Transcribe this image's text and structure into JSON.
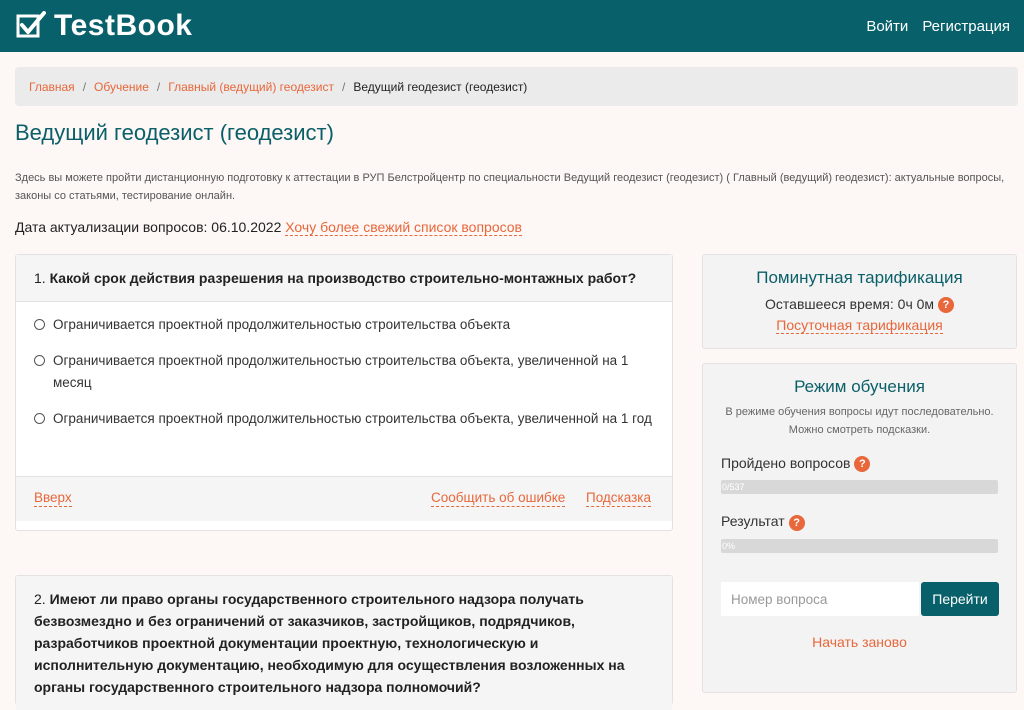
{
  "header": {
    "brand": "TestBook",
    "login": "Войти",
    "register": "Регистрация"
  },
  "breadcrumb": {
    "items": [
      "Главная",
      "Обучение",
      "Главный (ведущий) геодезист"
    ],
    "separator": "/",
    "current": "Ведущий геодезист (геодезист)"
  },
  "page": {
    "title": "Ведущий геодезист (геодезист)",
    "intro": "Здесь вы можете пройти дистанционную подготовку к аттестации в РУП Белстройцентр по специальности Ведущий геодезист (геодезист) ( Главный (ведущий) геодезист): актуальные вопросы, законы со статьями, тестирование онлайн.",
    "updated_label": "Дата актуализации вопросов: 06.10.2022",
    "updated_link": "Хочу более свежий список вопросов"
  },
  "questions": [
    {
      "number": "1.",
      "text": "Какой срок действия разрешения на производство строительно-монтажных работ?",
      "answers": [
        "Ограничивается проектной продолжительностью строительства объекта",
        "Ограничивается проектной продолжительностью строительства объекта, увеличенной на 1 месяц",
        "Ограничивается проектной продолжительностью строительства объекта, увеличенной на 1 год"
      ],
      "footer": {
        "top": "Вверх",
        "report": "Сообщить об ошибке",
        "hint": "Подсказка"
      }
    },
    {
      "number": "2.",
      "text": "Имеют ли право органы государственного строительного надзора получать безвозмездно и без ограничений от заказчиков, застройщиков, подрядчиков, разработчиков проектной документации проектную, технологическую и исполнительную документацию, необходимую для осуществления возложенных на органы государственного строительного надзора полномочий?"
    }
  ],
  "tariff": {
    "title": "Поминутная тарификация",
    "time_label": "Оставшееся время: 0ч 0м",
    "help": "?",
    "daily_link": "Посуточная тарификация"
  },
  "training": {
    "title": "Режим обучения",
    "description": "В режиме обучения вопросы идут последовательно. Можно смотреть подсказки.",
    "passed_label": "Пройдено вопросов",
    "passed_value": "0/537",
    "passed_fraction": 0,
    "result_label": "Результат",
    "result_value": "0%",
    "result_fraction": 0,
    "input_placeholder": "Номер вопроса",
    "go_button": "Перейти",
    "restart": "Начать заново"
  },
  "colors": {
    "header": "#08616a",
    "accent": "#e8673b",
    "title": "#0b5f68"
  }
}
